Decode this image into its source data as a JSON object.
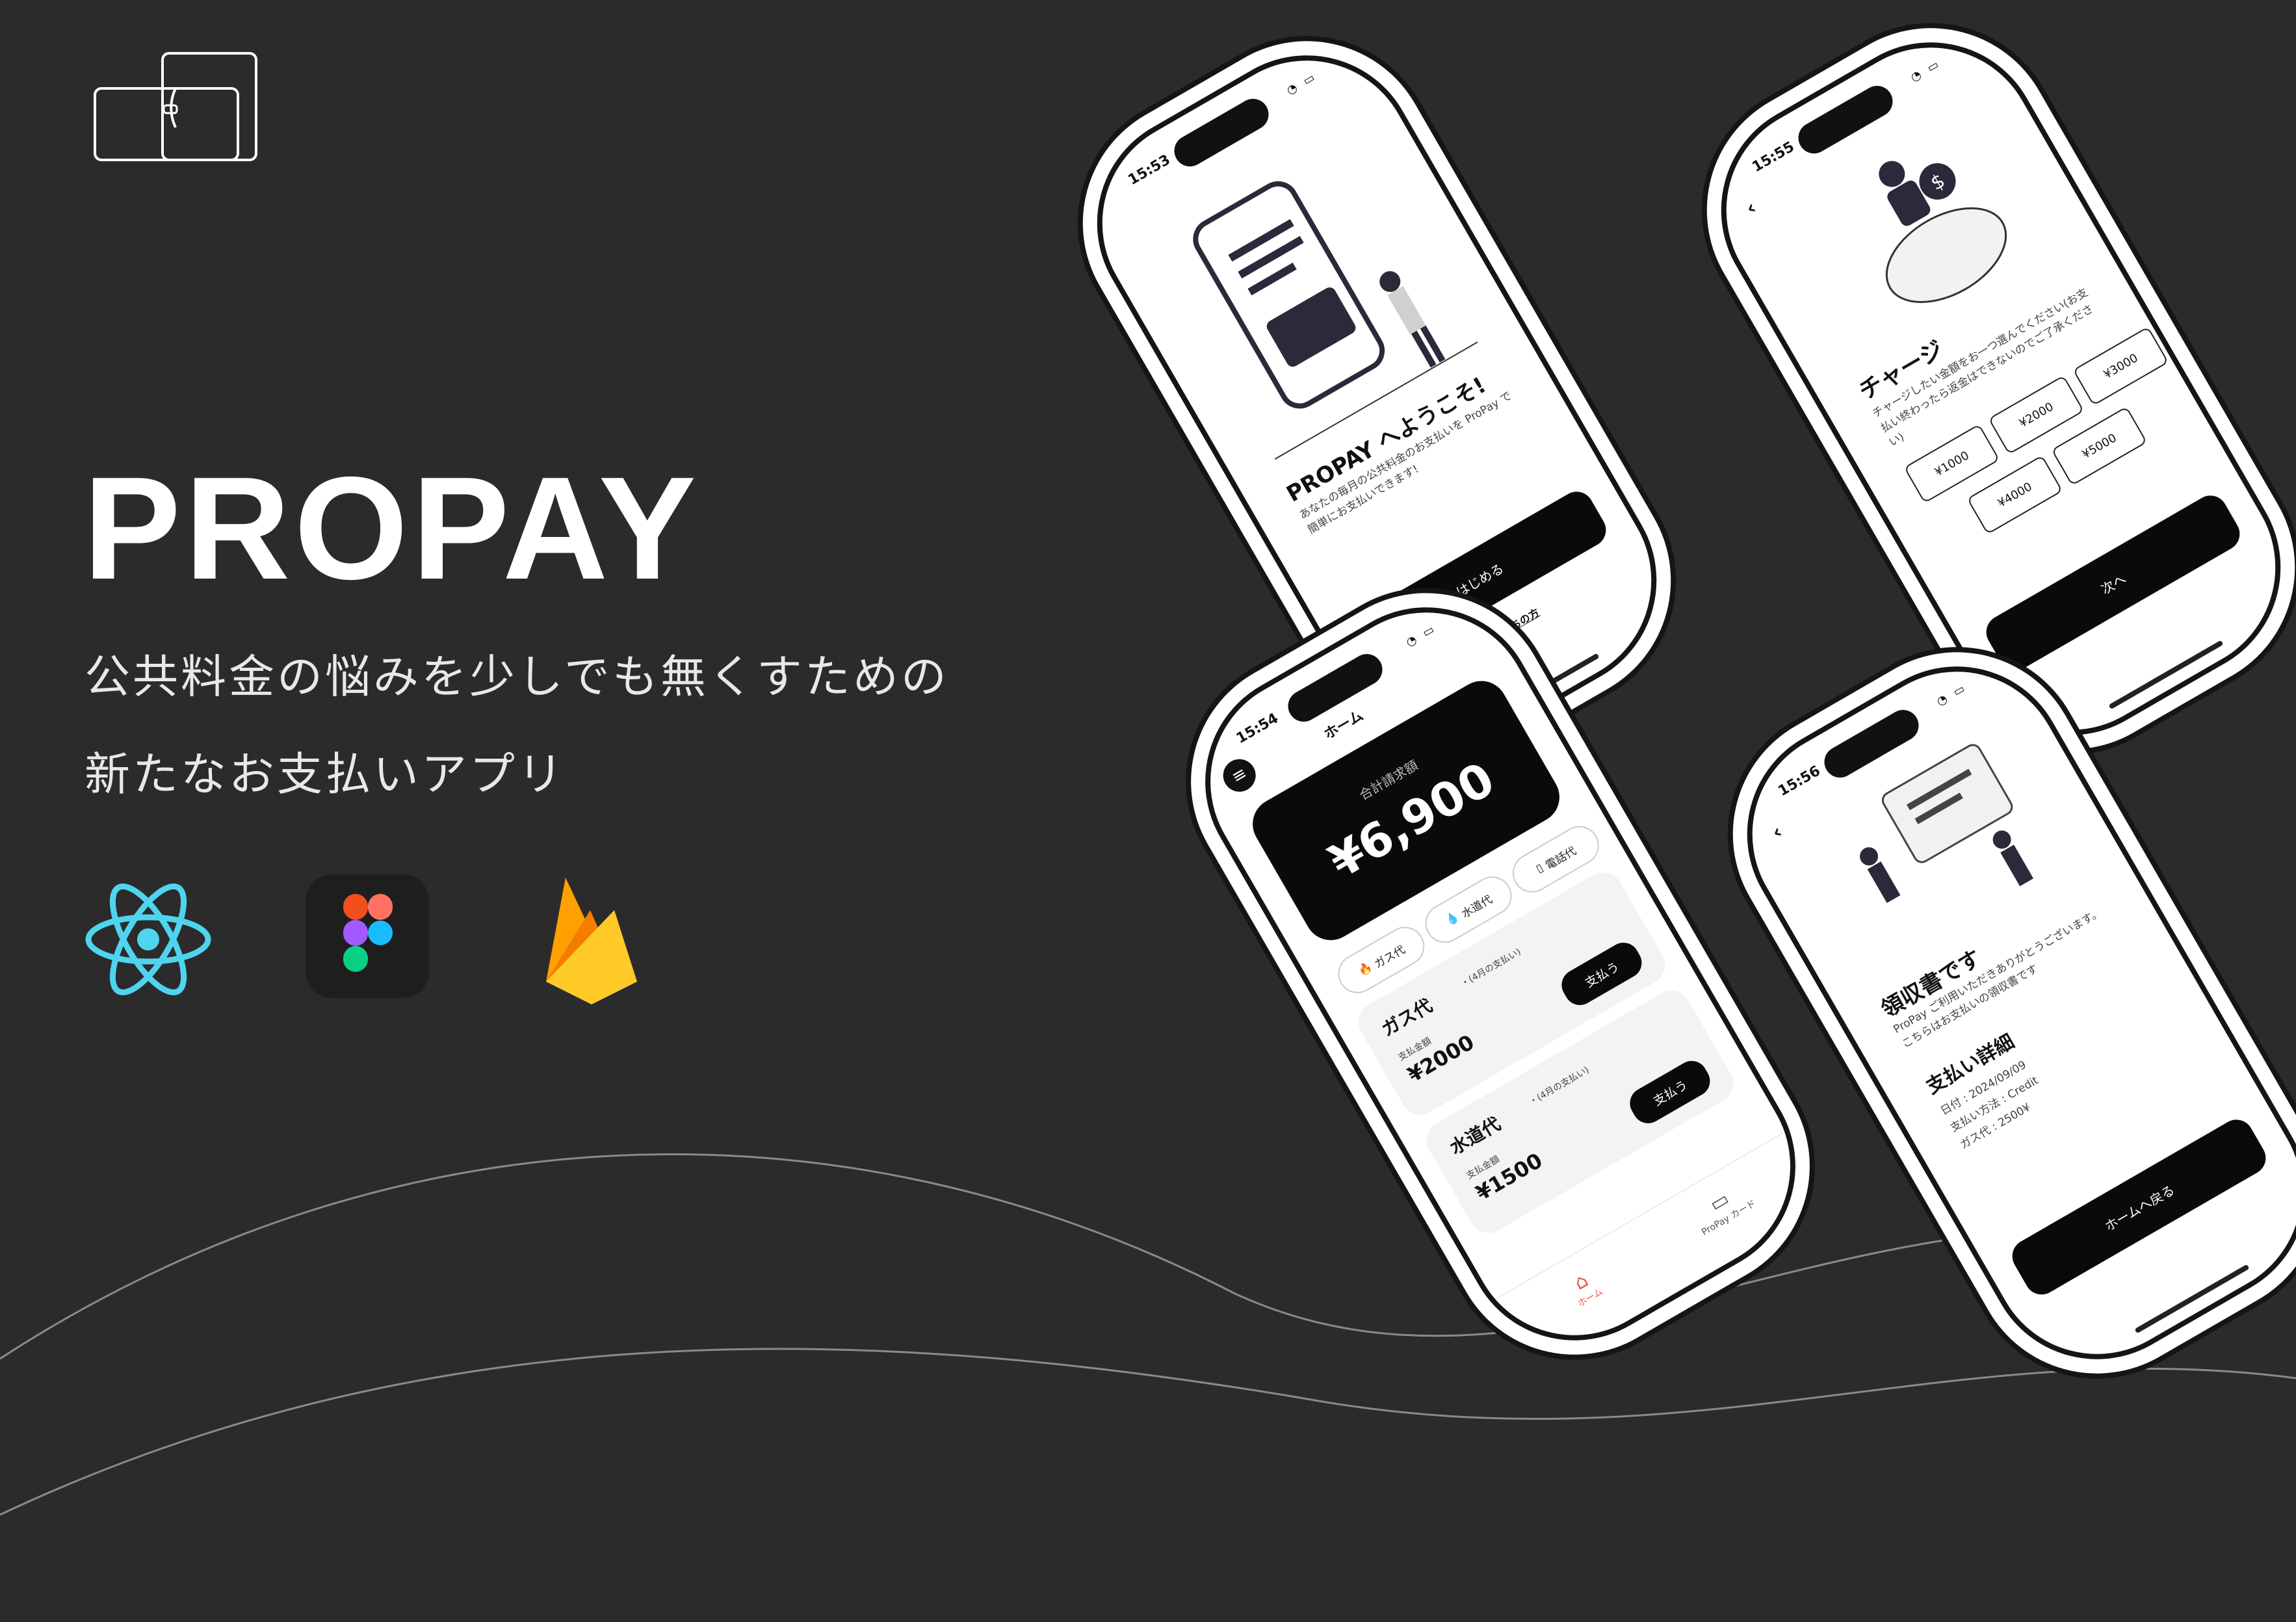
{
  "hero": {
    "title": "PROPAY",
    "subtitle_line1": "公共料金の悩みを少しでも無くすための",
    "subtitle_line2": "新たなお支払いアプリ"
  },
  "tech_icons": [
    "react-icon",
    "figma-icon",
    "firebase-icon"
  ],
  "colors": {
    "background": "#2b2b2b",
    "phone_screen": "#ffffff",
    "accent_dark": "#0a0a0a",
    "tab_active": "#e8574a"
  },
  "welcome_screen": {
    "time": "15:53",
    "heading": "PROPAY へようこそ!",
    "description": "あなたの毎月の公共料金のお支払いを ProPay で簡単にお支払いできます!",
    "start_button": "はじめる",
    "account_link": "アカウント持ちの方"
  },
  "charge_screen": {
    "time": "15:55",
    "heading": "チャージ",
    "description": "チャージしたい金額をお一つ選んでください(お支払い終わったら返金はできないのでご了承ください)",
    "amounts": [
      "¥1000",
      "¥2000",
      "¥3000",
      "¥4000",
      "¥5000"
    ],
    "next_button": "次へ"
  },
  "home_screen": {
    "time": "15:54",
    "header_title": "ホーム",
    "total_label": "合計請求額",
    "total_amount": "¥6,900",
    "categories": [
      "ガス代",
      "水道代",
      "電話代"
    ],
    "bills": [
      {
        "name": "ガス代",
        "note": "・(4月の支払い)",
        "amount_label": "支払金額",
        "amount": "¥2000",
        "pay_button": "支払う"
      },
      {
        "name": "水道代",
        "note": "・(4月の支払い)",
        "amount_label": "支払金額",
        "amount": "¥1500",
        "pay_button": "支払う"
      }
    ],
    "tabs": [
      "ホーム",
      "ProPay カード"
    ]
  },
  "receipt_screen": {
    "time": "15:56",
    "heading": "領収書です",
    "thanks": "ProPay ご利用いただきありがとうございます。こちらはお支払いの領収書です",
    "detail_heading": "支払い詳細",
    "date": "日付 : 2024/09/09",
    "method": "支払い方法 : Credit",
    "gas": "ガス代 : 2500¥",
    "home_button": "ホームへ戻る"
  }
}
